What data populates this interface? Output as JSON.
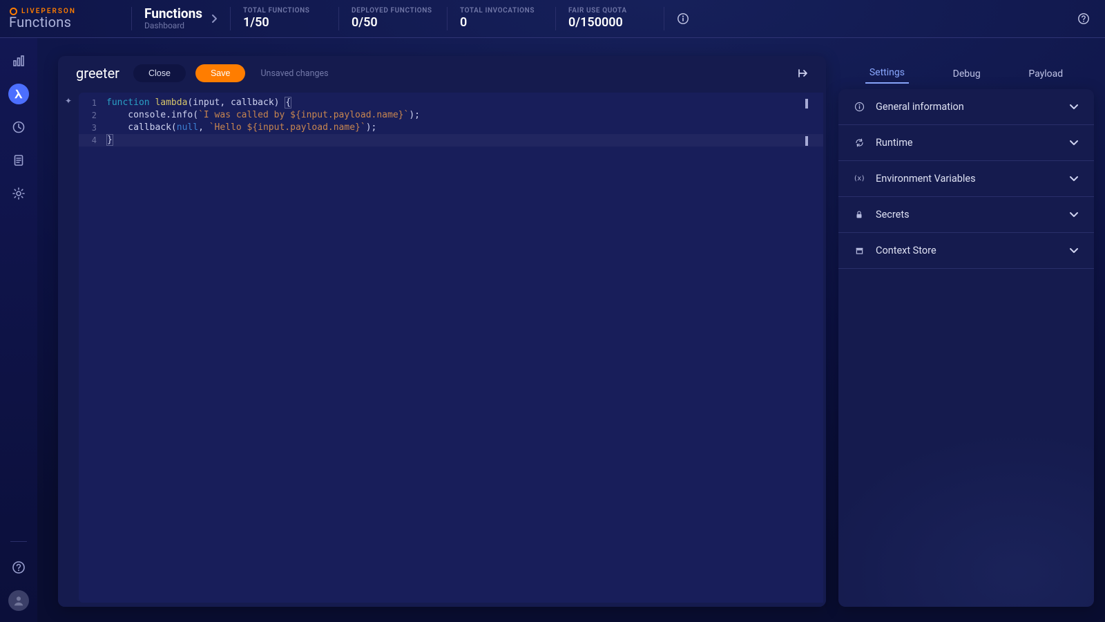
{
  "brand": {
    "top": "LIVEPERSON",
    "bottom": "Functions"
  },
  "breadcrumb": {
    "title": "Functions",
    "sub": "Dashboard"
  },
  "stats": [
    {
      "label": "TOTAL FUNCTIONS",
      "value": "1/50"
    },
    {
      "label": "DEPLOYED FUNCTIONS",
      "value": "0/50"
    },
    {
      "label": "TOTAL INVOCATIONS",
      "value": "0"
    },
    {
      "label": "FAIR USE QUOTA",
      "value": "0/150000"
    }
  ],
  "sidebar": {
    "items": [
      {
        "name": "analytics",
        "icon": "bar-chart-icon"
      },
      {
        "name": "functions",
        "icon": "lambda-icon",
        "active": true
      },
      {
        "name": "schedules",
        "icon": "clock-icon"
      },
      {
        "name": "logs",
        "icon": "document-icon"
      },
      {
        "name": "settings",
        "icon": "gear-icon"
      }
    ]
  },
  "editor": {
    "name": "greeter",
    "close_label": "Close",
    "save_label": "Save",
    "status": "Unsaved changes",
    "gutter_icon": "sparkle-icon"
  },
  "code_lines": [
    {
      "n": "1"
    },
    {
      "n": "2"
    },
    {
      "n": "3"
    },
    {
      "n": "4"
    }
  ],
  "code": {
    "l1_kw": "function",
    "l1_fn": " lambda",
    "l1_rest1": "(input, callback) ",
    "l1_brace": "{",
    "l2_a": "    console.info(",
    "l2_str": "`I was called by ${input.payload.name}`",
    "l2_b": ");",
    "l3_a": "    callback(",
    "l3_null": "null",
    "l3_b": ", ",
    "l3_str": "`Hello ${input.payload.name}`",
    "l3_c": ");",
    "l4_brace": "}"
  },
  "right_panel": {
    "tabs": [
      {
        "label": "Settings",
        "active": true
      },
      {
        "label": "Debug"
      },
      {
        "label": "Payload"
      }
    ],
    "sections": [
      {
        "icon": "info-icon",
        "label": "General information"
      },
      {
        "icon": "refresh-icon",
        "label": "Runtime"
      },
      {
        "icon": "variable-icon",
        "label": "Environment Variables"
      },
      {
        "icon": "lock-icon",
        "label": "Secrets"
      },
      {
        "icon": "store-icon",
        "label": "Context Store"
      }
    ]
  },
  "icons": {
    "info": "ⓘ",
    "help": "?",
    "variable": "(x)"
  },
  "colors": {
    "accent": "#ff7d00",
    "accent_blue": "#4c6fff"
  }
}
